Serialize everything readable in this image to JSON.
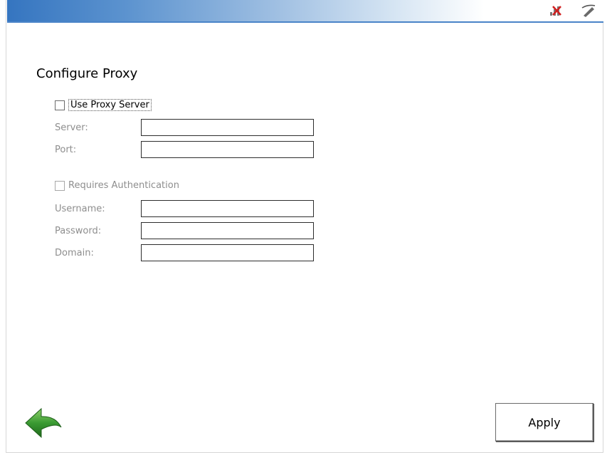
{
  "window": {
    "title_icons": [
      "network-disconnected-icon",
      "pen-icon"
    ]
  },
  "page": {
    "title": "Configure Proxy"
  },
  "proxy": {
    "use_proxy_label": "Use Proxy Server",
    "use_proxy_checked": false,
    "server_label": "Server:",
    "server_value": "",
    "port_label": "Port:",
    "port_value": ""
  },
  "auth": {
    "requires_auth_label": "Requires Authentication",
    "requires_auth_checked": false,
    "username_label": "Username:",
    "username_value": "",
    "password_label": "Password:",
    "password_value": "",
    "domain_label": "Domain:",
    "domain_value": ""
  },
  "footer": {
    "apply_label": "Apply",
    "back_icon": "back-arrow-icon"
  },
  "colors": {
    "titlebar_start": "#3575c0",
    "disabled_text": "#8e8e8e",
    "back_arrow": "#3a9a32"
  }
}
